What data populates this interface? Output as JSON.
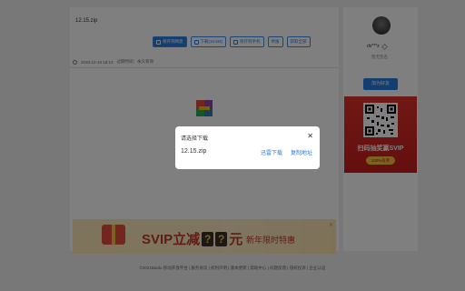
{
  "file": {
    "name": "12.15.zip",
    "meta_time": "2020-12-15 16:14",
    "meta_expiry": "过期时间：永久有效"
  },
  "actions": [
    {
      "label": "保存到网盘",
      "icon": "save-icon"
    },
    {
      "label": "下载(16.5M)",
      "icon": "download-icon"
    },
    {
      "label": "保存到手机",
      "icon": "phone-icon"
    },
    {
      "label": "举报",
      "icon": ""
    },
    {
      "label": "获取全部",
      "icon": ""
    }
  ],
  "banner": {
    "main": "SVIP立减",
    "q1": "?",
    "q2": "?",
    "unit": "元",
    "sub": "新年限时特惠",
    "gift_label": "SVIP"
  },
  "sidebar": {
    "username": "dx***z",
    "subtitle": "暂无签名",
    "follow_label": "加为好友",
    "promo_text": "扫码抽奖赢SVIP",
    "promo_pill": "100%有奖"
  },
  "footer": {
    "text": "©2021Baidu 移动开放平台 | 服务协议 | 权利声明 | 版本更新 | 帮助中心 | 问题反馈 | 侵权投诉 | 企业认证"
  },
  "dialog": {
    "title": "请选择下载",
    "file_name": "12.15.zip",
    "fast_download": "迅雷下载",
    "copy_link": "复制地址",
    "close": "✕"
  },
  "colors": {
    "accent": "#2a7de1",
    "promo": "#e0312b",
    "overlay": "rgba(0,0,0,0.5)"
  }
}
